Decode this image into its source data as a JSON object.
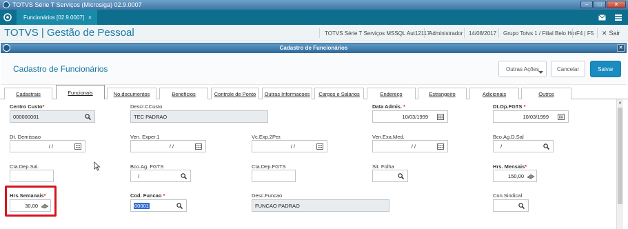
{
  "window": {
    "title": "TOTVS Série T Serviços (Microsiga) 02.9.0007"
  },
  "tabbar": {
    "tab_label": "Funcionários [02.9.0007]",
    "tab_close": "×"
  },
  "appheader": {
    "title": "TOTVS | Gestão de Pessoal",
    "environment": "TOTVS Série T Serviços MSSQL Aut12117",
    "user": "Administrador",
    "date": "14/08/2017",
    "company": "Grupo Totvs 1 / Filial Belo Hor",
    "shortcuts": "F4 | F5",
    "sair": "Sair"
  },
  "dialog": {
    "window_title": "Cadastro de Funcionários",
    "title": "Cadastro de Funcionários",
    "actions": {
      "outras": "Outras Ações",
      "cancelar": "Cancelar",
      "salvar": "Salvar"
    }
  },
  "tabs": [
    "Cadastrais",
    "Funcionais",
    "No.documentos",
    "Beneficios",
    "Controle de Ponto",
    "Outras Informacoes",
    "Cargos e Salarios",
    "Endereço",
    "Estrangeiro",
    "Adicionais",
    "Outros"
  ],
  "active_tab": "Funcionais",
  "fields": {
    "centro_custo": {
      "label": "Centro Custo",
      "value": "000000001"
    },
    "descr_ccusto": {
      "label": "Descr.CCusto",
      "value": "TEC PADRAO"
    },
    "data_admis": {
      "label": "Data Admis.",
      "value": "10/03/1999"
    },
    "dt_op_fgts": {
      "label": "Dt.Op.FGTS",
      "value": "10/03/1999"
    },
    "dt_demissao": {
      "label": "Dt. Demissao",
      "value": "/ /"
    },
    "ven_exper1": {
      "label": "Ven. Exper.1",
      "value": "/ /"
    },
    "vc_exp_2per": {
      "label": "Vc.Exp.2Per.",
      "value": "/ /"
    },
    "ven_exa_med": {
      "label": "Ven.Exa.Med.",
      "value": "/ /"
    },
    "bco_ag_d_sal": {
      "label": "Bco.Ag.D.Sal",
      "value": "/"
    },
    "cta_dep_sal": {
      "label": "Cta.Dep.Sal.",
      "value": ""
    },
    "bco_ag_fgts": {
      "label": "Bco.Ag. FGTS",
      "value": "/"
    },
    "cta_dep_fgts": {
      "label": "Cta.Dep.FGTS",
      "value": ""
    },
    "sit_folha": {
      "label": "Sit. Folha",
      "value": ""
    },
    "hrs_mensais": {
      "label": "Hrs. Mensais",
      "value": "150,00"
    },
    "hrs_semanais": {
      "label": "Hrs.Semanais",
      "value": "30,00"
    },
    "cod_funcao": {
      "label": "Cod. Funcao",
      "value": "00001"
    },
    "desc_funcao": {
      "label": "Desc.Funcao",
      "value": "FUNCAO PADRAO"
    },
    "con_sindical": {
      "label": "Con.Sindical",
      "value": ""
    }
  },
  "required_mark": "*",
  "colors": {
    "accent": "#1877a3",
    "tabbar": "#0d6e8e",
    "primary_button": "#1a8cc0",
    "highlight": "#d6121f"
  }
}
